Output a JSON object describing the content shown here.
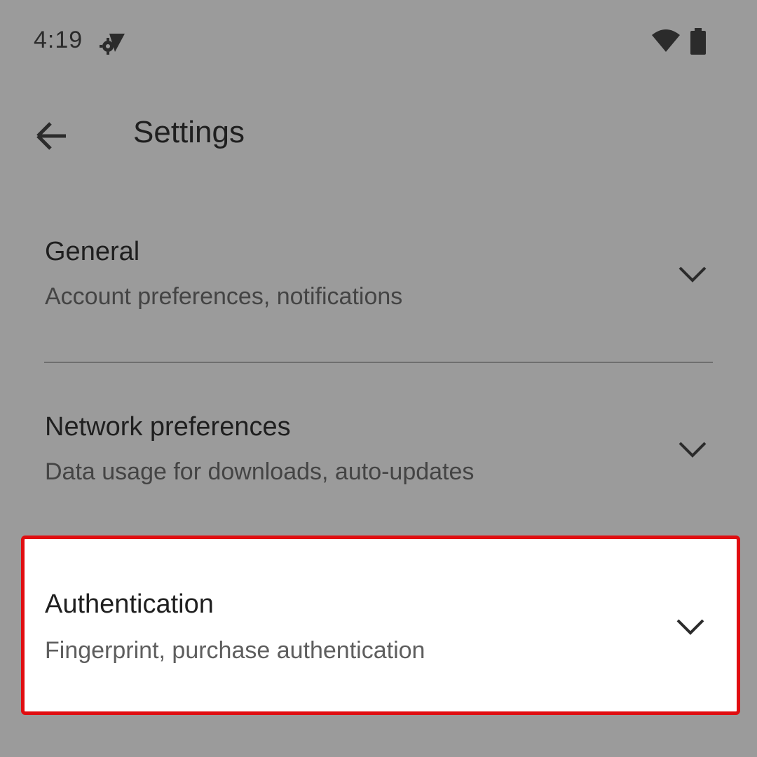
{
  "status_bar": {
    "time": "4:19",
    "icons": [
      "settings-icon",
      "wifi-icon",
      "battery-icon"
    ]
  },
  "app_bar": {
    "back_icon": "arrow-left-icon",
    "title": "Settings"
  },
  "settings": {
    "items": [
      {
        "title": "General",
        "subtitle": "Account preferences, notifications",
        "icon": "chevron-down-icon"
      },
      {
        "title": "Network preferences",
        "subtitle": "Data usage for downloads, auto-updates",
        "icon": "chevron-down-icon"
      },
      {
        "title": "Authentication",
        "subtitle": "Fingerprint, purchase authentication",
        "icon": "chevron-down-icon",
        "highlighted": true
      }
    ]
  },
  "colors": {
    "background": "#9b9b9b",
    "highlight_border": "#e00d10",
    "highlight_fill": "#ffffff",
    "text_primary": "#1f1f1f",
    "text_secondary": "#444444"
  }
}
